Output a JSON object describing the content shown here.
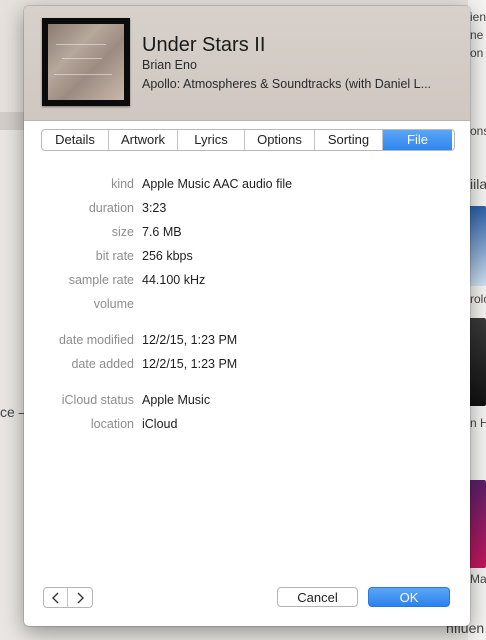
{
  "background": {
    "fragments": [
      "ien",
      "ne",
      "on",
      "ons",
      "iila",
      "rolo",
      "ce –",
      "n H",
      "Ma",
      "nfluen"
    ]
  },
  "header": {
    "title": "Under Stars II",
    "artist": "Brian Eno",
    "album": "Apollo: Atmospheres & Soundtracks (with Daniel L..."
  },
  "tabs": [
    {
      "label": "Details",
      "active": false
    },
    {
      "label": "Artwork",
      "active": false
    },
    {
      "label": "Lyrics",
      "active": false
    },
    {
      "label": "Options",
      "active": false
    },
    {
      "label": "Sorting",
      "active": false
    },
    {
      "label": "File",
      "active": true
    }
  ],
  "file_info": {
    "kind": {
      "label": "kind",
      "value": "Apple Music AAC audio file"
    },
    "duration": {
      "label": "duration",
      "value": "3:23"
    },
    "size": {
      "label": "size",
      "value": "7.6 MB"
    },
    "bit_rate": {
      "label": "bit rate",
      "value": "256 kbps"
    },
    "sample_rate": {
      "label": "sample rate",
      "value": "44.100 kHz"
    },
    "volume": {
      "label": "volume",
      "value": ""
    },
    "date_modified": {
      "label": "date modified",
      "value": "12/2/15, 1:23 PM"
    },
    "date_added": {
      "label": "date added",
      "value": "12/2/15, 1:23 PM"
    },
    "icloud_status": {
      "label": "iCloud status",
      "value": "Apple Music"
    },
    "location": {
      "label": "location",
      "value": "iCloud"
    }
  },
  "buttons": {
    "cancel": "Cancel",
    "ok": "OK"
  },
  "icons": {
    "prev": "chevron-left-icon",
    "next": "chevron-right-icon"
  },
  "colors": {
    "accent": "#2f86ef",
    "label_gray": "#8d8d8d"
  }
}
